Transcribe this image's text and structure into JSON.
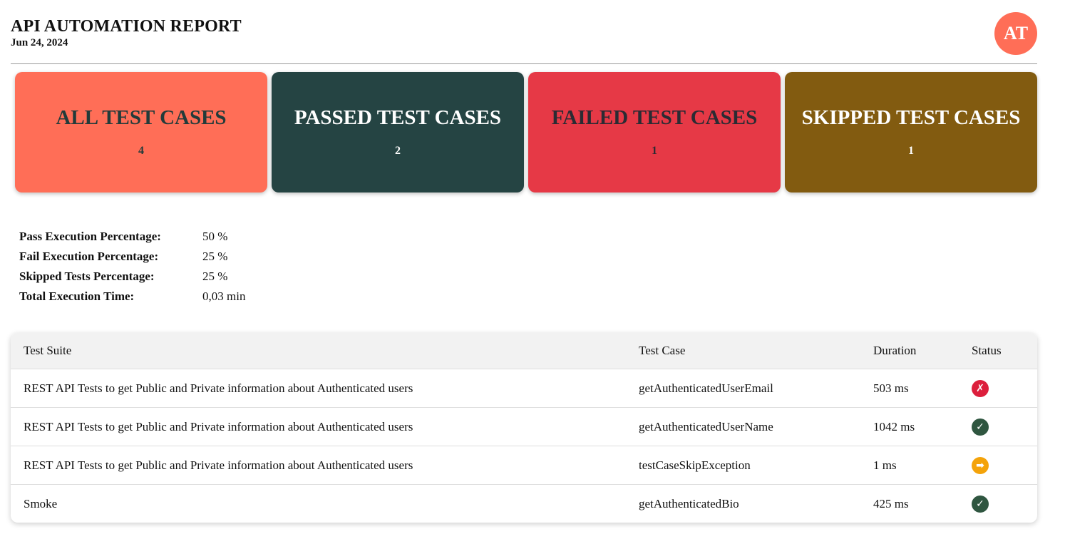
{
  "header": {
    "title": "API AUTOMATION REPORT",
    "date": "Jun 24, 2024",
    "avatar_initials": "AT"
  },
  "cards": [
    {
      "title": "ALL TEST CASES",
      "count": "4",
      "bg": "#ff6e57",
      "fg": "#233b3a"
    },
    {
      "title": "PASSED TEST CASES",
      "count": "2",
      "bg": "#254443",
      "fg": "#ffffff"
    },
    {
      "title": "FAILED TEST CASES",
      "count": "1",
      "bg": "#e63946",
      "fg": "#2b2b33"
    },
    {
      "title": "SKIPPED TEST CASES",
      "count": "1",
      "bg": "#825b10",
      "fg": "#ffffff"
    }
  ],
  "stats": [
    {
      "label": "Pass Execution Percentage:",
      "value": "50 %"
    },
    {
      "label": "Fail Execution Percentage:",
      "value": "25 %"
    },
    {
      "label": "Skipped Tests Percentage:",
      "value": "25 %"
    },
    {
      "label": "Total Execution Time:",
      "value": "0,03 min"
    }
  ],
  "table": {
    "headers": [
      "Test Suite",
      "Test Case",
      "Duration",
      "Status"
    ],
    "rows": [
      {
        "suite": "REST API Tests to get Public and Private information about Authenticated users",
        "case": "getAuthenticatedUserEmail",
        "duration": "503 ms",
        "status": "failed",
        "status_icon": "x-mark-icon"
      },
      {
        "suite": "REST API Tests to get Public and Private information about Authenticated users",
        "case": "getAuthenticatedUserName",
        "duration": "1042 ms",
        "status": "passed",
        "status_icon": "check-mark-icon"
      },
      {
        "suite": "REST API Tests to get Public and Private information about Authenticated users",
        "case": "testCaseSkipException",
        "duration": "1 ms",
        "status": "skipped",
        "status_icon": "arrow-right-icon"
      },
      {
        "suite": "Smoke",
        "case": "getAuthenticatedBio",
        "duration": "425 ms",
        "status": "passed",
        "status_icon": "check-mark-icon"
      }
    ]
  },
  "status_colors": {
    "failed": "#dc1f3c",
    "passed": "#2f5640",
    "skipped": "#f4a30a"
  }
}
